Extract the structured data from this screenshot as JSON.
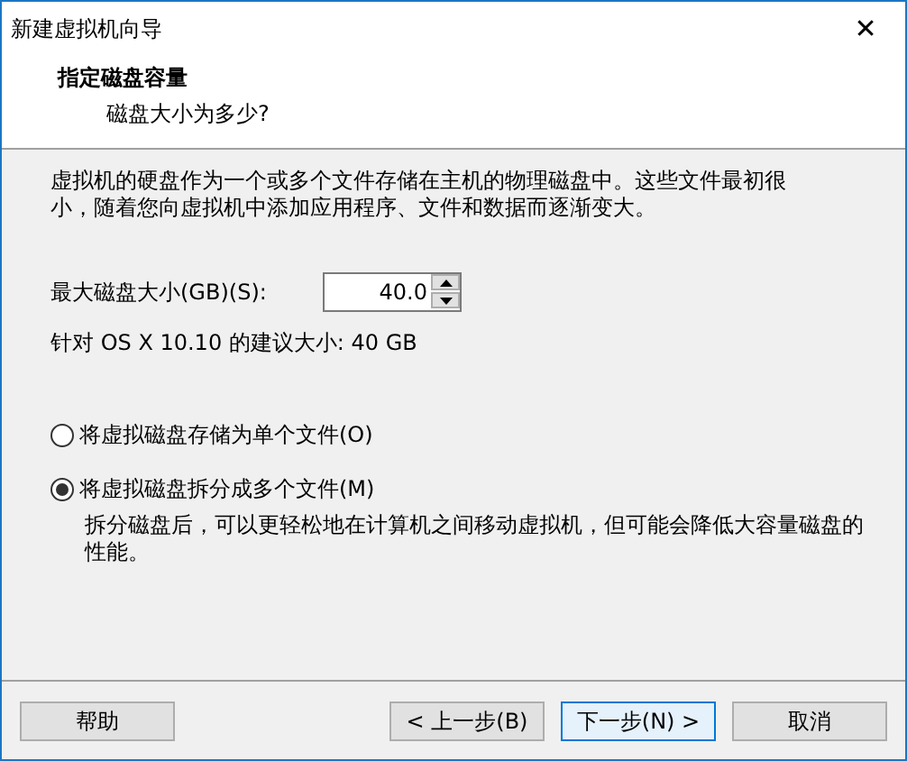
{
  "window": {
    "title": "新建虚拟机向导",
    "close": "✕"
  },
  "header": {
    "title": "指定磁盘容量",
    "subtitle": "磁盘大小为多少?"
  },
  "description": "虚拟机的硬盘作为一个或多个文件存储在主机的物理磁盘中。这些文件最初很小，随着您向虚拟机中添加应用程序、文件和数据而逐渐变大。",
  "disk_size": {
    "label": "最大磁盘大小(GB)(S):",
    "value": "40.0"
  },
  "recommendation": "针对 OS X 10.10 的建议大小: 40 GB",
  "storage_options": [
    {
      "label": "将虚拟磁盘存储为单个文件(O)",
      "selected": false
    },
    {
      "label": "将虚拟磁盘拆分成多个文件(M)",
      "selected": true,
      "note": "拆分磁盘后，可以更轻松地在计算机之间移动虚拟机，但可能会降低大容量磁盘的性能。"
    }
  ],
  "buttons": [
    {
      "label": "帮助",
      "default": false
    },
    {
      "label": "< 上一步(B)",
      "default": false
    },
    {
      "label": "下一步(N) >",
      "default": true
    },
    {
      "label": "取消",
      "default": false
    }
  ]
}
